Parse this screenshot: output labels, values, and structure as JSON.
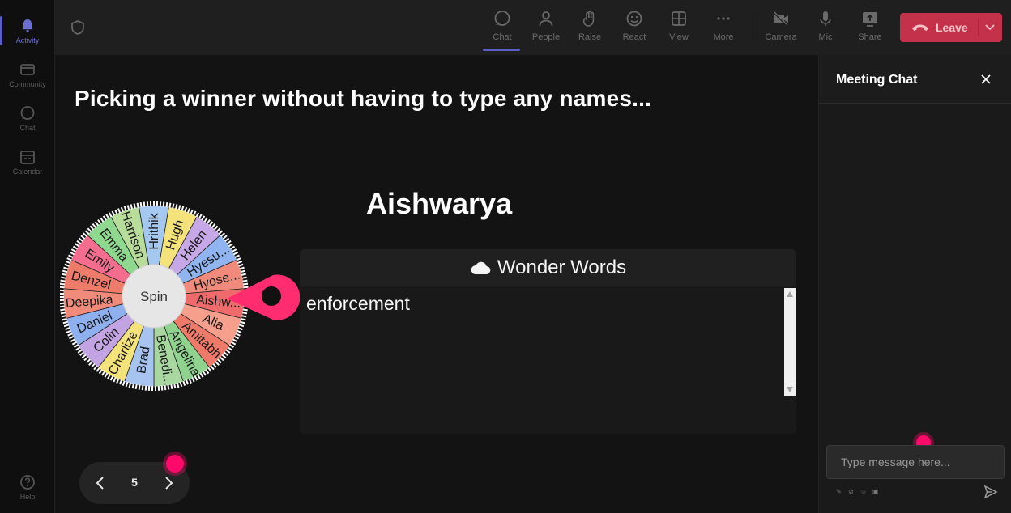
{
  "rail": {
    "items": [
      {
        "label": "Activity",
        "icon": "bell-icon",
        "active": true
      },
      {
        "label": "Community",
        "icon": "community-icon",
        "active": false
      },
      {
        "label": "Chat",
        "icon": "chat-icon",
        "active": false
      },
      {
        "label": "Calendar",
        "icon": "calendar-icon",
        "active": false
      }
    ],
    "help_label": "Help"
  },
  "toolbar": {
    "buttons": [
      {
        "label": "Chat",
        "icon": "chat-icon",
        "active": true
      },
      {
        "label": "People",
        "icon": "people-icon"
      },
      {
        "label": "Raise",
        "icon": "hand-icon"
      },
      {
        "label": "React",
        "icon": "smiley-icon"
      },
      {
        "label": "View",
        "icon": "grid-icon"
      },
      {
        "label": "More",
        "icon": "more-icon"
      },
      {
        "label": "Camera",
        "icon": "camera-off-icon"
      },
      {
        "label": "Mic",
        "icon": "mic-icon"
      },
      {
        "label": "Share",
        "icon": "share-icon"
      }
    ],
    "leave_label": "Leave",
    "leave_color": "#c4314b"
  },
  "stage": {
    "headline": "Picking a winner without having to type any names...",
    "winner": "Aishwarya",
    "wheel": {
      "center_label": "Spin",
      "segments": [
        {
          "name": "Hrithik",
          "color": "#a5c8f0"
        },
        {
          "name": "Hugh",
          "color": "#f4e27a"
        },
        {
          "name": "Helen",
          "color": "#c7a8e6"
        },
        {
          "name": "Hyesu...",
          "color": "#8fb4f0"
        },
        {
          "name": "Hyose...",
          "color": "#f08b7c"
        },
        {
          "name": "Aishw...",
          "color": "#ef6b6b"
        },
        {
          "name": "Alia",
          "color": "#f59f8c"
        },
        {
          "name": "Amitabh",
          "color": "#f07a6a"
        },
        {
          "name": "Angelina",
          "color": "#8fd38f"
        },
        {
          "name": "Benedi...",
          "color": "#a8d8a0"
        },
        {
          "name": "Brad",
          "color": "#a7c4f0"
        },
        {
          "name": "Charlize",
          "color": "#f4e27a"
        },
        {
          "name": "Colin",
          "color": "#c3a4e3"
        },
        {
          "name": "Daniel",
          "color": "#8fb0ee"
        },
        {
          "name": "Deepika",
          "color": "#f08b7c"
        },
        {
          "name": "Denzel",
          "color": "#ef7b6b"
        },
        {
          "name": "Emily",
          "color": "#f46d8f"
        },
        {
          "name": "Emma",
          "color": "#8fd88f"
        },
        {
          "name": "Harrison",
          "color": "#b8dc9a"
        }
      ],
      "pointer_color": "#ff2d6f"
    },
    "wonder_words": {
      "title": "Wonder Words",
      "icon": "cloud-icon",
      "words": [
        "enforcement"
      ]
    },
    "pager": {
      "page": "5"
    }
  },
  "chat": {
    "title": "Meeting Chat",
    "input_placeholder": "Type message here..."
  },
  "accent": "#5b5fc7",
  "cursor_color": "#ff0a6b"
}
